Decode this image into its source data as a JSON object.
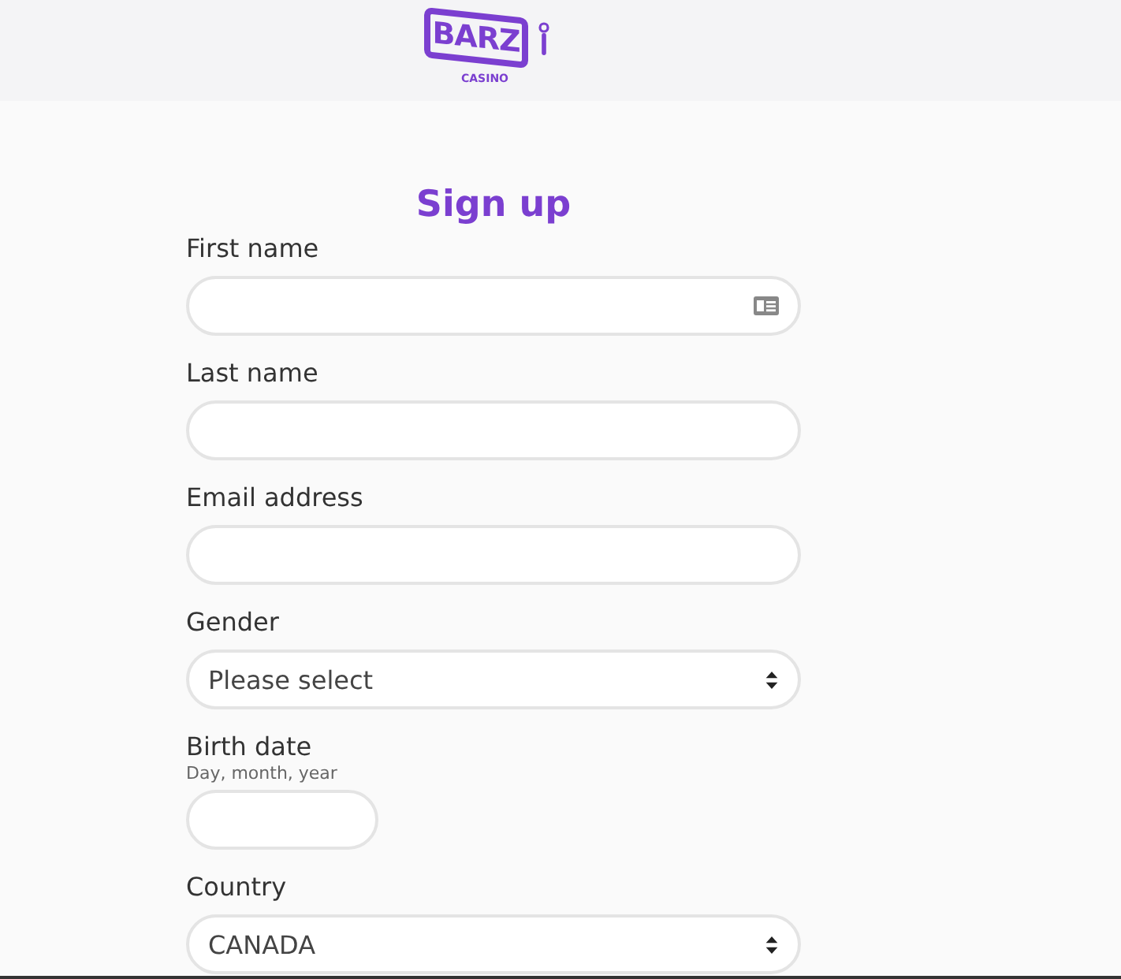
{
  "logo": {
    "wordmark": "BARZ",
    "tagline": "CASINO"
  },
  "title": "Sign up",
  "fields": [
    {
      "kind": "text",
      "label": "First name",
      "contact_icon": true
    },
    {
      "kind": "text",
      "label": "Last name",
      "contact_icon": false
    },
    {
      "kind": "text",
      "label": "Email address",
      "contact_icon": false
    },
    {
      "kind": "select",
      "label": "Gender",
      "value": "Please select",
      "contact_icon": false
    },
    {
      "kind": "date",
      "label": "Birth date",
      "hint": "Day, month, year",
      "contact_icon": false
    },
    {
      "kind": "select",
      "label": "Country",
      "value": "CANADA",
      "contact_icon": false
    }
  ]
}
